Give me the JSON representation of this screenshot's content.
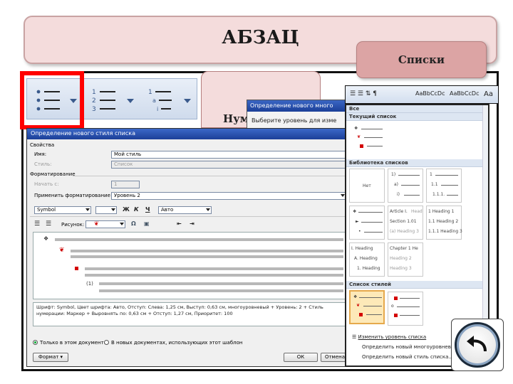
{
  "title": "АБЗАЦ",
  "tab_lists": "Списки",
  "tab_numbered": "Нум",
  "define_dialog": {
    "title": "Определение нового много",
    "text": "Выберите уровень для изме"
  },
  "dialog": {
    "title": "Определение нового стиля списка",
    "section_properties": "Свойства",
    "name_label": "Имя:",
    "name_value": "Мой стиль",
    "style_label": "Стиль:",
    "style_value": "Список",
    "section_format": "Форматирование",
    "start_label": "Начать с:",
    "start_value": "1",
    "apply_label": "Применить форматирование к:",
    "apply_value": "Уровень 2",
    "font_value": "Symbol",
    "color_value": "Авто",
    "bold": "Ж",
    "italic": "К",
    "underline": "Ч",
    "picture_label": "Рисунок:",
    "preview_number": "(1)",
    "description": "Шрифт: Symbol, Цвет шрифта: Авто, Отступ: Слева: 1,25 см, Выступ: 0,63 см, многоуровневый + Уровень: 2 + Стиль нумерации: Маркер + Выровнять по: 0,63 см + Отступ: 1,27 см, Приоритет: 100",
    "radio_doc": "Только в этом документе",
    "radio_template": "В новых документах, использующих этот шаблон",
    "format_button": "Формат ▾",
    "ok_button": "ОК",
    "cancel_button": "Отмена"
  },
  "styles_ribbon": {
    "sample1": "AaBbCcDc",
    "sample2": "AaBbCcDc",
    "sample3": "Aa"
  },
  "panel": {
    "header_all": "Все",
    "current_list": "Текущий список",
    "library": "Библиотека списков",
    "none_label": "Нет",
    "num_items": [
      "1)",
      "a)",
      "i)"
    ],
    "num2_items": [
      "1",
      "1.1",
      "1.1.1."
    ],
    "article_items": [
      "Article I.",
      "Section 1.01",
      "(a) Heading 3"
    ],
    "article_suffix": [
      "Head",
      ""
    ],
    "heading_items": [
      "1 Heading 1",
      "1.1 Heading 2",
      "1.1.1 Heading 3"
    ],
    "heading_a_items": [
      "I. Heading",
      "A. Heading",
      "1. Heading"
    ],
    "chapter_items": [
      "Chapter 1 He",
      "Heading 2",
      "Heading 3"
    ],
    "styles_list": "Список стилей",
    "link_change_level": "Изменить уровень списка",
    "link_define_multi": "Определить новый многоуровневый...",
    "link_define_style": "Определить новый стиль списка..."
  }
}
